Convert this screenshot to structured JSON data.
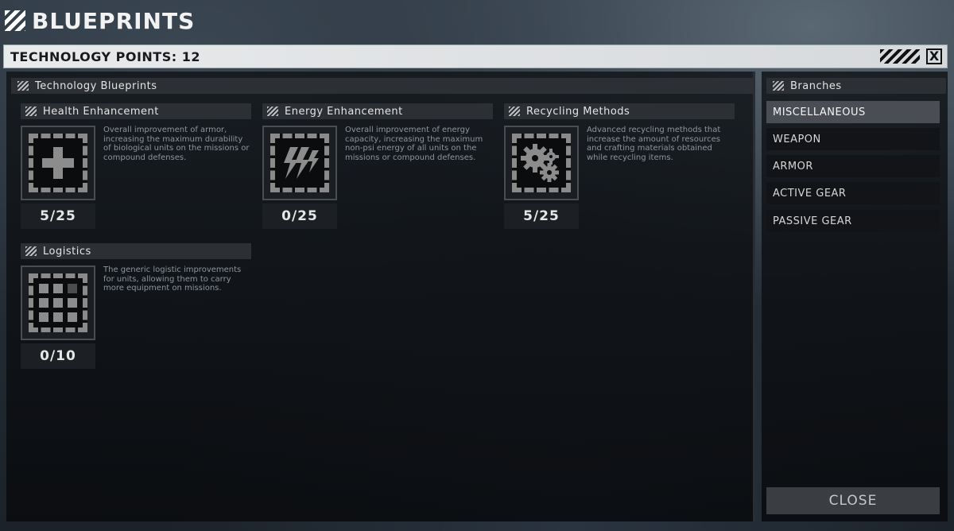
{
  "window": {
    "title": "BLUEPRINTS"
  },
  "topbar": {
    "tech_points": "TECHNOLOGY POINTS: 12",
    "close_symbol": "X"
  },
  "blueprints": {
    "heading": "Technology Blueprints",
    "cards": [
      {
        "title": "Health Enhancement",
        "icon": "plus-icon",
        "desc": "Overall improvement of armor, increasing the maximum durability of biological units on the missions or compound defenses.",
        "count": "5/25"
      },
      {
        "title": "Energy Enhancement",
        "icon": "lightning-icon",
        "desc": "Overall improvement of energy capacity, increasing the maximum non-psi energy of all units on the missions or compound defenses.",
        "count": "0/25"
      },
      {
        "title": "Recycling Methods",
        "icon": "gears-icon",
        "desc": "Advanced recycling methods that increase the amount of resources and crafting materials obtained while recycling items.",
        "count": "5/25"
      },
      {
        "title": "Logistics",
        "icon": "grid-icon",
        "desc": "The generic logistic improvements for units, allowing them to carry more equipment on missions.",
        "count": "0/10"
      }
    ]
  },
  "branches": {
    "heading": "Branches",
    "items": [
      {
        "label": "MISCELLANEOUS",
        "active": true
      },
      {
        "label": "WEAPON",
        "active": false
      },
      {
        "label": "ARMOR",
        "active": false
      },
      {
        "label": "ACTIVE GEAR",
        "active": false
      },
      {
        "label": "PASSIVE GEAR",
        "active": false
      }
    ],
    "close_label": "CLOSE"
  }
}
